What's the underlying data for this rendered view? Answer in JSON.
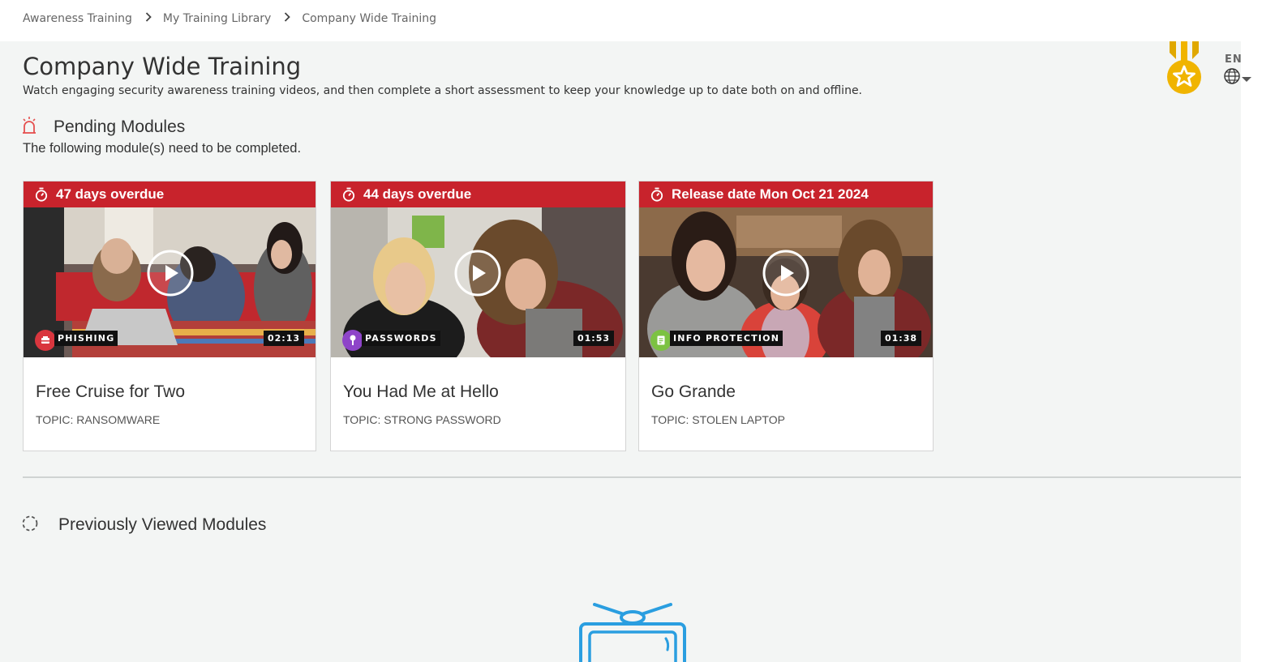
{
  "breadcrumb": {
    "items": [
      "Awareness Training",
      "My Training Library",
      "Company Wide Training"
    ]
  },
  "page": {
    "title": "Company Wide Training",
    "description": "Watch engaging security awareness training videos, and then complete a short assessment to keep your knowledge up to date both on and offline."
  },
  "language": {
    "code": "EN"
  },
  "pending": {
    "heading": "Pending Modules",
    "subtitle": "The following module(s) need to be completed."
  },
  "modules": [
    {
      "status": "47 days overdue",
      "category": "PHISHING",
      "category_color": "#d9363e",
      "duration": "02:13",
      "title": "Free Cruise for Two",
      "topic": "TOPIC: RANSOMWARE"
    },
    {
      "status": "44 days overdue",
      "category": "PASSWORDS",
      "category_color": "#8e44c9",
      "duration": "01:53",
      "title": "You Had Me at Hello",
      "topic": "TOPIC: STRONG PASSWORD"
    },
    {
      "status": "Release date Mon Oct 21 2024",
      "category": "INFO PROTECTION",
      "category_color": "#7cc242",
      "duration": "01:38",
      "title": "Go Grande",
      "topic": "TOPIC: STOLEN LAPTOP"
    }
  ],
  "previous": {
    "heading": "Previously Viewed Modules"
  },
  "colors": {
    "status_red": "#c8232c",
    "medal_gold": "#f0b400",
    "tv_blue": "#2a9ee0",
    "alarm_red": "#e5504f"
  }
}
